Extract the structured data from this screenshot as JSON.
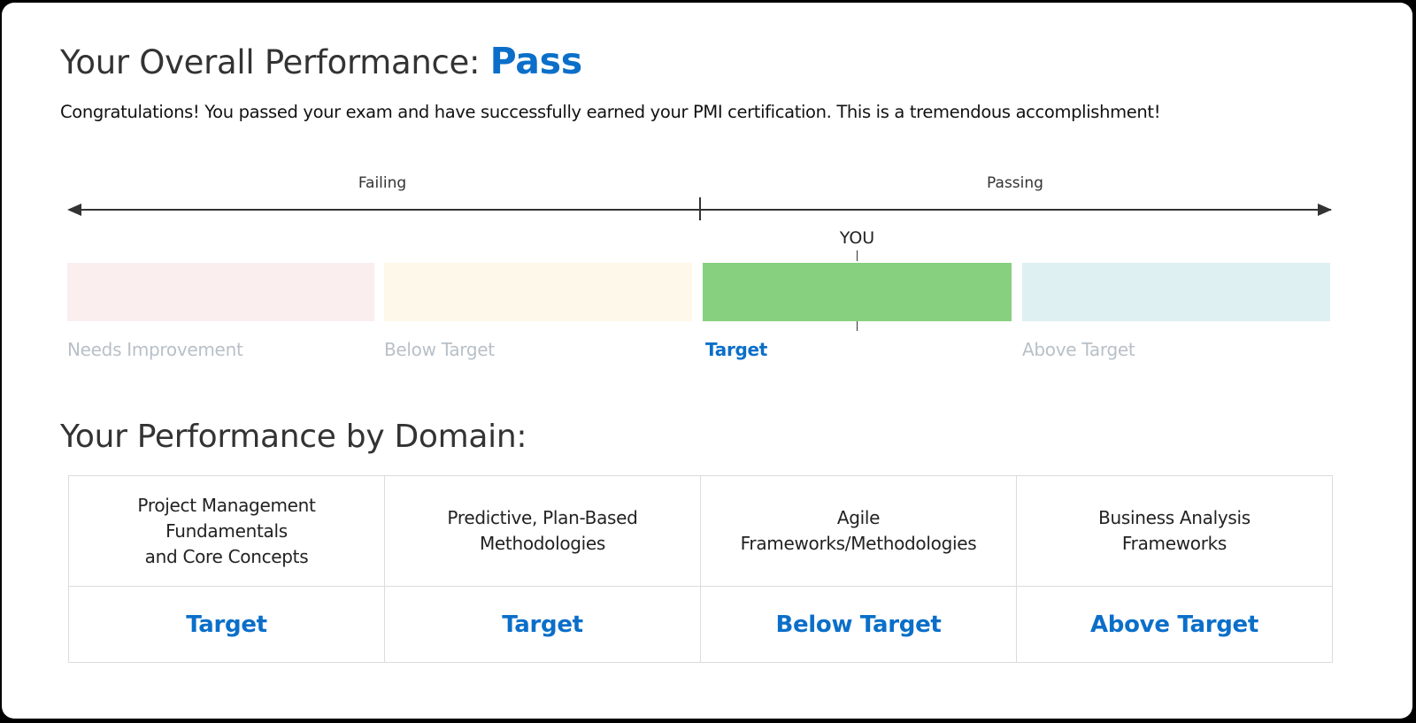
{
  "overall": {
    "title_prefix": "Your Overall Performance:",
    "result": "Pass",
    "message": "Congratulations! You passed your exam and have successfully earned your PMI certification. This is a tremendous accomplishment!"
  },
  "scale": {
    "failing_label": "Failing",
    "passing_label": "Passing",
    "you_label": "YOU",
    "you_position_in_target_band": 0.5,
    "bands": [
      {
        "label": "Needs Improvement",
        "color": "#fbeeee",
        "label_color": "#b8c0c8",
        "active": false
      },
      {
        "label": "Below Target",
        "color": "#fef8ea",
        "label_color": "#b8c0c8",
        "active": false
      },
      {
        "label": "Target",
        "color": "#86d07f",
        "label_color": "#0b6fc9",
        "active": true
      },
      {
        "label": "Above Target",
        "color": "#dff0f3",
        "label_color": "#b8c0c8",
        "active": false
      }
    ]
  },
  "domains": {
    "title": "Your Performance by Domain:",
    "columns": [
      {
        "header_lines": [
          "Project Management",
          "Fundamentals",
          "and Core Concepts"
        ],
        "rating": "Target"
      },
      {
        "header_lines": [
          "Predictive, Plan-Based",
          "Methodologies"
        ],
        "rating": "Target"
      },
      {
        "header_lines": [
          "Agile",
          "Frameworks/Methodologies"
        ],
        "rating": "Below Target"
      },
      {
        "header_lines": [
          "Business Analysis",
          "Frameworks"
        ],
        "rating": "Above Target"
      }
    ]
  },
  "colors": {
    "accent": "#0b6fc9",
    "heading": "#333333",
    "muted_label": "#b8c0c8"
  }
}
